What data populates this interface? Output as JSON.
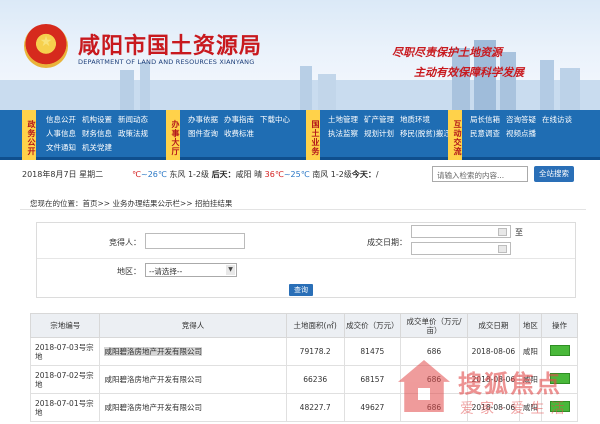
{
  "header": {
    "title": "咸阳市国土资源局",
    "subtitle": "DEPARTMENT OF LAND AND RESOURCES XIANYANG",
    "slogan_line1": "尽职尽责保护土地资源",
    "slogan_line2": "主动有效保障科学发展"
  },
  "nav": {
    "groups": [
      {
        "tag": "政务公开",
        "links": [
          "信息公开",
          "机构设置",
          "新闻动态",
          "人事信息",
          "财务信息",
          "政策法规",
          "文件通知",
          "机关党建"
        ]
      },
      {
        "tag": "办事大厅",
        "links": [
          "办事依据",
          "办事指南",
          "下载中心",
          "图件查询",
          "收费标准"
        ]
      },
      {
        "tag": "国土业务",
        "links": [
          "土地管理",
          "矿产管理",
          "地质环境",
          "执法监察",
          "规划计划",
          "移民(脱贫)搬迁"
        ]
      },
      {
        "tag": "互动交流",
        "links": [
          "局长信箱",
          "咨询答疑",
          "在线访谈",
          "民意调查",
          "视频点播"
        ]
      }
    ]
  },
  "weather": {
    "date": "2018年8月7日",
    "weekday": "星期二",
    "today_temp_low": "℃",
    "today_temp_high": "26℃",
    "today_wind": "东风 1-2级",
    "label_after": "后天：",
    "city": "咸阳",
    "condition": "晴",
    "after_high": "36℃",
    "after_low": "25℃",
    "after_wind": "南风 1-2级",
    "label_today": "今天：",
    "today_tail": "/"
  },
  "search": {
    "placeholder": "请输入检索的内容...",
    "button": "全站搜索"
  },
  "breadcrumb": "您现在的位置：首页>> 业务办理结果公示栏>> 招拍挂结果",
  "form": {
    "winner_label": "竞得人：",
    "date_label": "成交日期：",
    "to_label": "至",
    "region_label": "地区：",
    "region_value": "--请选择--",
    "query_button": "查询"
  },
  "table": {
    "headers": [
      "宗地编号",
      "竞得人",
      "土地面积(㎡)",
      "成交价（万元）",
      "成交单价（万元/亩）",
      "成交日期",
      "地区",
      "操作"
    ],
    "rows": [
      {
        "id": "2018-07-03号宗地",
        "winner": "咸阳碧洛房地产开发有限公司",
        "area": "79178.2",
        "price": "81475",
        "unit_price": "686",
        "date": "2018-08-06",
        "region": "咸阳"
      },
      {
        "id": "2018-07-02号宗地",
        "winner": "咸阳碧洛房地产开发有限公司",
        "area": "66236",
        "price": "68157",
        "unit_price": "686",
        "date": "2018-08-06",
        "region": "咸阳"
      },
      {
        "id": "2018-07-01号宗地",
        "winner": "咸阳碧洛房地产开发有限公司",
        "area": "48227.7",
        "price": "49627",
        "unit_price": "686",
        "date": "2018-08-06",
        "region": "咸阳"
      }
    ]
  },
  "watermark": {
    "brand": "搜狐焦点",
    "tagline": "爱家·爱生活"
  }
}
